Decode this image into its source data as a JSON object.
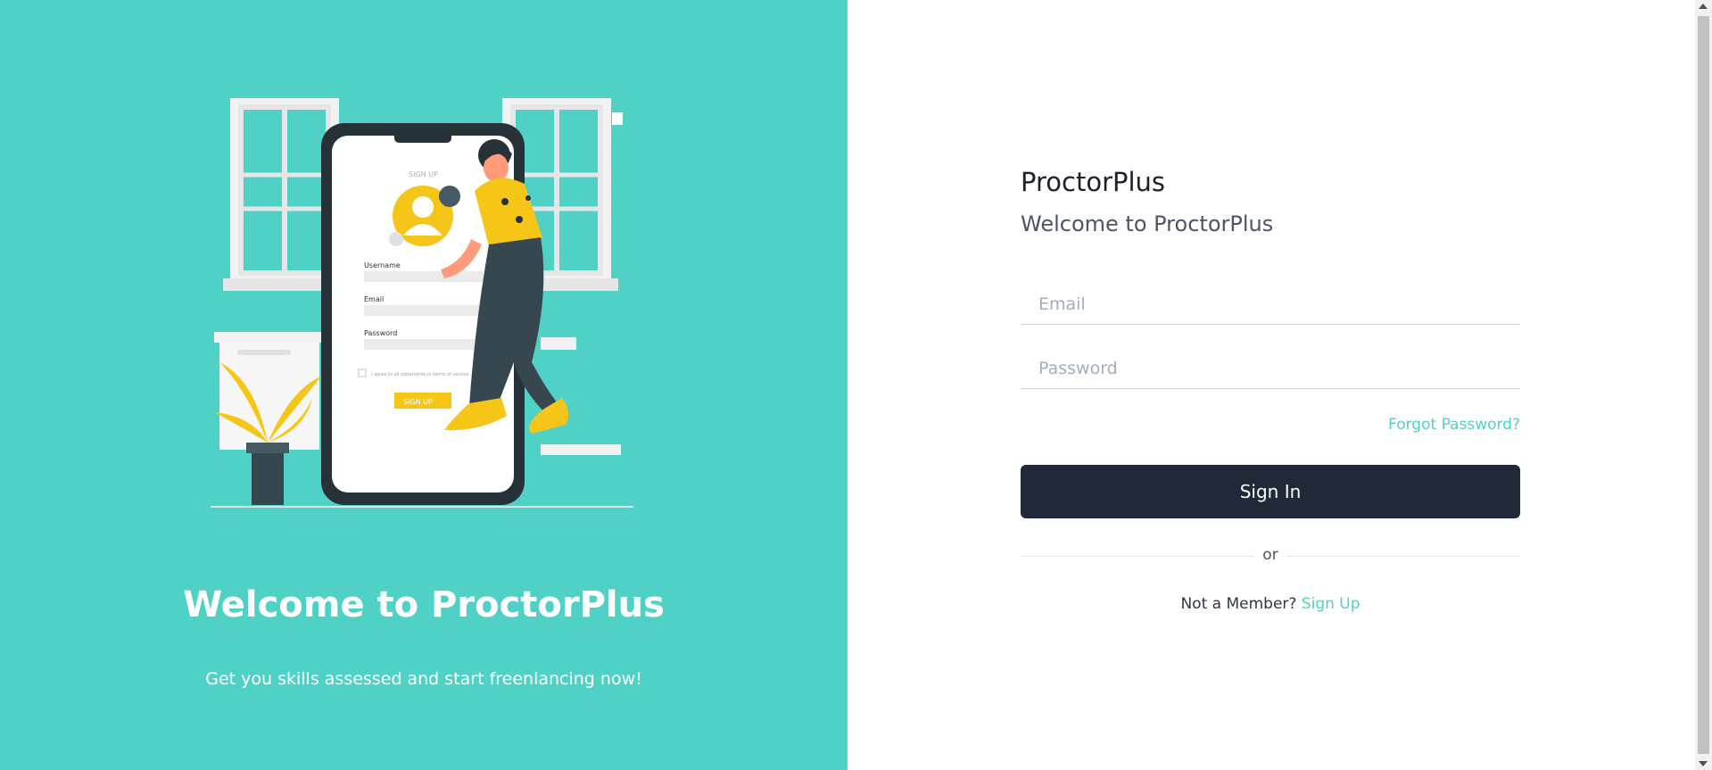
{
  "hero": {
    "title": "Welcome to ProctorPlus",
    "subtitle": "Get you skills assessed and start freenlancing now!",
    "illustration": {
      "screen_title": "SIGN UP",
      "username_label": "Username",
      "email_label": "Email",
      "password_label": "Password",
      "terms_text": "I agree to all statements in terms of service",
      "button_label": "SIGN UP"
    }
  },
  "form": {
    "brand": "ProctorPlus",
    "welcome": "Welcome to ProctorPlus",
    "email_placeholder": "Email",
    "password_placeholder": "Password",
    "forgot_label": "Forgot Password?",
    "signin_label": "Sign In",
    "divider_label": "or",
    "not_member_text": "Not a Member?",
    "signup_label": "Sign Up"
  },
  "colors": {
    "accent": "#4fd1c5",
    "button": "#1f2937",
    "illustration_yellow": "#f5c518"
  }
}
